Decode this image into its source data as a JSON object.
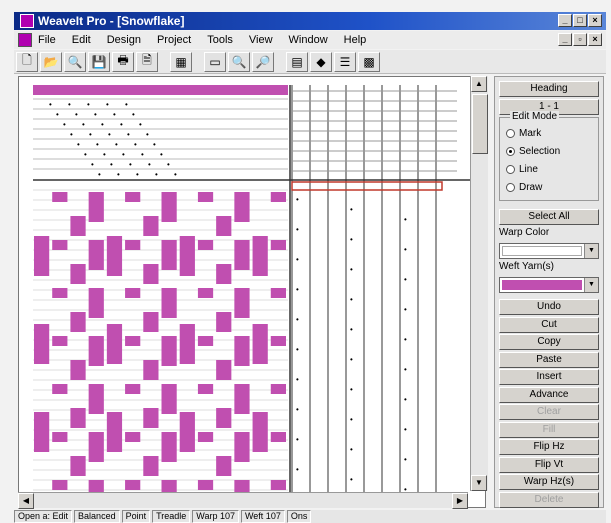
{
  "window": {
    "title": "WeaveIt Pro - [Snowflake]",
    "min_icon": "minimize-icon",
    "max_icon": "maximize-icon",
    "close_icon": "close-icon"
  },
  "menu": [
    "File",
    "Edit",
    "Design",
    "Project",
    "Tools",
    "View",
    "Window",
    "Help"
  ],
  "toolbar": [
    {
      "name": "new-icon",
      "glyph": "🗋"
    },
    {
      "name": "open-icon",
      "glyph": "📂"
    },
    {
      "name": "search-icon",
      "glyph": "🔍"
    },
    {
      "name": "save-icon",
      "glyph": "💾"
    },
    {
      "name": "print-icon",
      "glyph": "🖶"
    },
    {
      "name": "preview-icon",
      "glyph": "🗎"
    },
    {
      "name": "grid-view-icon",
      "glyph": "▦"
    },
    {
      "name": "window-icon",
      "glyph": "▭"
    },
    {
      "name": "zoom-in-icon",
      "glyph": "🔍"
    },
    {
      "name": "zoom-out-icon",
      "glyph": "🔎"
    },
    {
      "name": "fabric-icon",
      "glyph": "▤"
    },
    {
      "name": "color-icon",
      "glyph": "◆"
    },
    {
      "name": "lines-icon",
      "glyph": "☰"
    },
    {
      "name": "tiles-icon",
      "glyph": "▩"
    }
  ],
  "colors": {
    "accent": "#c04fb0",
    "threading_line": "#c0392b"
  },
  "panel": {
    "heading_label": "Heading",
    "heading_value": "1 - 1",
    "edit_mode_label": "Edit Mode",
    "modes": [
      {
        "label": "Mark",
        "on": false
      },
      {
        "label": "Selection",
        "on": true
      },
      {
        "label": "Line",
        "on": false
      },
      {
        "label": "Draw",
        "on": false
      }
    ],
    "select_all": "Select All",
    "warp_color_label": "Warp Color",
    "weft_yarn_label": "Weft Yarn(s)",
    "buttons": [
      {
        "label": "Undo",
        "enabled": true
      },
      {
        "label": "Cut",
        "enabled": true
      },
      {
        "label": "Copy",
        "enabled": true
      },
      {
        "label": "Paste",
        "enabled": true
      },
      {
        "label": "Insert",
        "enabled": true
      },
      {
        "label": "Advance",
        "enabled": true
      },
      {
        "label": "Clear",
        "enabled": false
      },
      {
        "label": "Fill",
        "enabled": false
      },
      {
        "label": "Flip Hz",
        "enabled": true
      },
      {
        "label": "Flip Vt",
        "enabled": true
      },
      {
        "label": "Warp Hz(s)",
        "enabled": true
      },
      {
        "label": "Delete",
        "enabled": false
      }
    ]
  },
  "status": [
    "Open a: Edit",
    "Balanced",
    "Point",
    "Treadle",
    "Warp 107",
    "Weft 107",
    "Ons"
  ]
}
